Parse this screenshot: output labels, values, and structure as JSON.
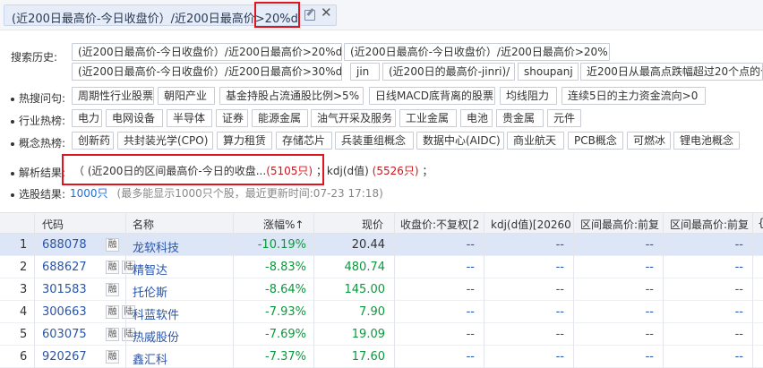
{
  "query": {
    "text": "(近200日最高价-今日收盘价）/近200日最高价",
    "highlight": ">20%d",
    "close_label": "✕"
  },
  "history": {
    "label": "搜索历史:",
    "items": [
      "(近200日最高价-今日收盘价）/近200日最高价>20%d",
      "(近200日最高价-今日收盘价）/近200日最高价>20%",
      "(近200日最高价-今日收盘价）/近200日最高价>30%d",
      "jin",
      "(近200日的最高价-jinri)/",
      "shoupanj",
      "近200日从最高点跌幅超过20个点的个"
    ]
  },
  "hot_questions": {
    "label": "热搜问句:",
    "items": [
      "周期性行业股票",
      "朝阳产业",
      "基金持股占流通股比例>5%",
      "日线MACD底背离的股票",
      "均线阻力",
      "连续5日的主力资金流向>0"
    ]
  },
  "industry": {
    "label": "行业热榜:",
    "items": [
      "电力",
      "电网设备",
      "半导体",
      "证券",
      "能源金属",
      "油气开采及服务",
      "工业金属",
      "电池",
      "贵金属",
      "元件"
    ]
  },
  "concept": {
    "label": "概念热榜:",
    "items": [
      "创新药",
      "共封装光学(CPO)",
      "算力租赁",
      "存储芯片",
      "兵装重组概念",
      "数据中心(AIDC)",
      "商业航天",
      "PCB概念",
      "可燃冰",
      "锂电池概念"
    ]
  },
  "parse": {
    "label": "解析结果:",
    "open": "（ (近200日的区间最高价-今日的收盘...",
    "count1": "(5105只)",
    "sep": "；kdj(d值)",
    "count2": "(5526只)",
    "end": "；"
  },
  "pick": {
    "label": "选股结果:",
    "count": "1000只",
    "note": "(最多能显示1000只个股，最近更新时间:07-23 17:18)"
  },
  "table": {
    "headers": [
      "代码",
      "名称",
      "涨幅%↑",
      "现价",
      "收盘价:不复权[2",
      "kdj(d值)[20260",
      "区间最高价:前复",
      "区间最高价:前复",
      "{"
    ],
    "rows": [
      {
        "idx": "1",
        "code": "688078",
        "badges": [
          "融"
        ],
        "name": "龙软科技",
        "pct": "-10.19%",
        "price": "20.44"
      },
      {
        "idx": "2",
        "code": "688627",
        "badges": [
          "融",
          "陆"
        ],
        "name": "精智达",
        "pct": "-8.83%",
        "price": "480.74"
      },
      {
        "idx": "3",
        "code": "301583",
        "badges": [
          "融"
        ],
        "name": "托伦斯",
        "pct": "-8.64%",
        "price": "145.00"
      },
      {
        "idx": "4",
        "code": "300663",
        "badges": [
          "融",
          "陆"
        ],
        "name": "科蓝软件",
        "pct": "-7.93%",
        "price": "7.90"
      },
      {
        "idx": "5",
        "code": "603075",
        "badges": [
          "融",
          "陆"
        ],
        "name": "热威股份",
        "pct": "-7.69%",
        "price": "19.09"
      },
      {
        "idx": "6",
        "code": "920267",
        "badges": [
          "融"
        ],
        "name": "鑫汇科",
        "pct": "-7.37%",
        "price": "17.60"
      }
    ],
    "dash": "--"
  },
  "colors": {
    "accent_red": "#e0141e",
    "down_green": "#0a9a3c",
    "link_blue": "#2a55a8"
  }
}
